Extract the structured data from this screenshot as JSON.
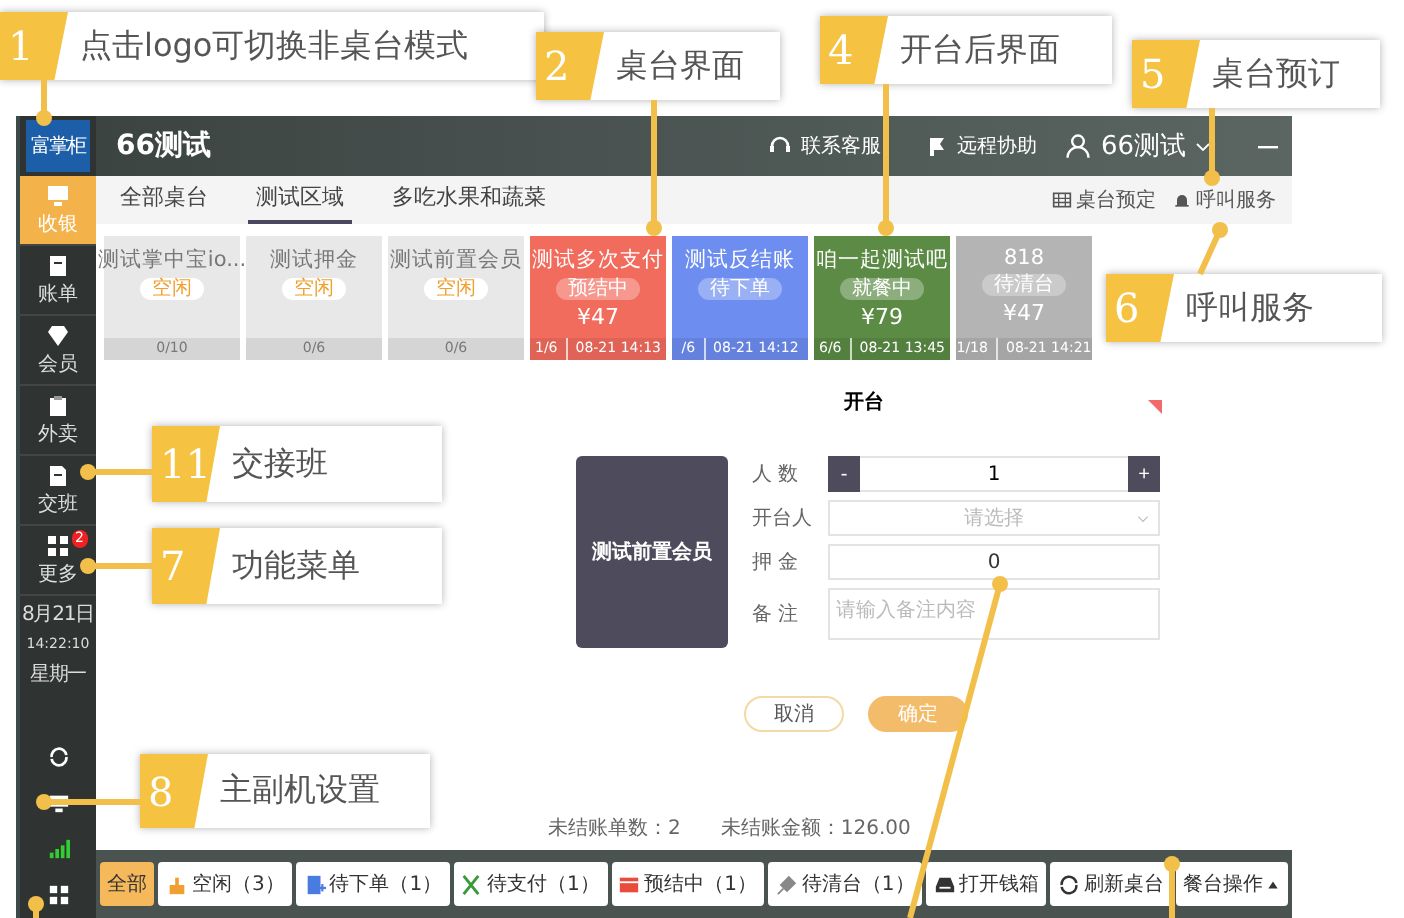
{
  "annotations": [
    {
      "number": "1",
      "text": "点击logo可切换非桌台模式"
    },
    {
      "number": "2",
      "text": "桌台界面"
    },
    {
      "number": "4",
      "text": "开台后界面"
    },
    {
      "number": "5",
      "text": "桌台预订"
    },
    {
      "number": "6",
      "text": "呼叫服务"
    },
    {
      "number": "11",
      "text": "交接班"
    },
    {
      "number": "7",
      "text": "功能菜单"
    },
    {
      "number": "8",
      "text": "主副机设置"
    }
  ],
  "sidebar": {
    "logo": "富掌柜",
    "items": [
      {
        "label": "收银",
        "selected": true
      },
      {
        "label": "账单",
        "selected": false
      },
      {
        "label": "会员",
        "selected": false
      },
      {
        "label": "外卖",
        "selected": false
      },
      {
        "label": "交班",
        "selected": false
      },
      {
        "label": "更多",
        "selected": false,
        "badge": "2"
      }
    ],
    "date": "8月21日",
    "time": "14:22:10",
    "weekday": "星期一"
  },
  "header": {
    "title": "66测试",
    "links": [
      "联系客服",
      "远程协助"
    ],
    "user": "66测试"
  },
  "tabs": [
    {
      "label": "全部桌台",
      "selected": false
    },
    {
      "label": "测试区域",
      "selected": true
    },
    {
      "label": "多吃水果和蔬菜",
      "selected": false
    }
  ],
  "tools": [
    "桌台预定",
    "呼叫服务"
  ],
  "tables": [
    {
      "name": "测试掌中宝io...",
      "status": "空闲",
      "kind": "idle",
      "color": "#e8e8e8",
      "count": "0/10"
    },
    {
      "name": "测试押金",
      "status": "空闲",
      "kind": "idle",
      "color": "#e8e8e8",
      "count": "0/6"
    },
    {
      "name": "测试前置会员",
      "status": "空闲",
      "kind": "idle",
      "color": "#e8e8e8",
      "count": "0/6"
    },
    {
      "name": "测试多次支付",
      "status": "预结中",
      "kind": "busy",
      "color": "#f26c5e",
      "price": "¥47",
      "count": "1/6",
      "time": "08-21 14:13"
    },
    {
      "name": "测试反结账",
      "status": "待下单",
      "kind": "busy",
      "color": "#6d8ef0",
      "count": "/6",
      "time": "08-21 14:12"
    },
    {
      "name": "咱一起测试吧",
      "status": "就餐中",
      "kind": "busy",
      "color": "#5b8b45",
      "price": "¥79",
      "count": "6/6",
      "time": "08-21 13:45"
    },
    {
      "name": "818",
      "status": "待清台",
      "kind": "busy",
      "color": "#b4b4b4",
      "price": "¥47",
      "count": "1/18",
      "time": "08-21 14:21"
    }
  ],
  "dialog": {
    "title": "开台",
    "table": "测试前置会员",
    "fields": [
      {
        "label": "人 数",
        "kind": "stepper",
        "minus": "-",
        "value": "1",
        "plus": "+"
      },
      {
        "label": "开台人",
        "kind": "select",
        "placeholder": "请选择"
      },
      {
        "label": "押 金",
        "kind": "input",
        "value": "0"
      },
      {
        "label": "备 注",
        "kind": "textarea",
        "placeholder": "请输入备注内容"
      }
    ],
    "buttons": [
      {
        "label": "取消",
        "primary": false
      },
      {
        "label": "确定",
        "primary": true
      }
    ]
  },
  "summary": [
    "未结账单数：2",
    "未结账金额：126.00"
  ],
  "filters": [
    {
      "label": "全部",
      "selected": true
    },
    {
      "label": "空闲（3）",
      "selected": false
    },
    {
      "label": "待下单（1）",
      "selected": false
    },
    {
      "label": "待支付（1）",
      "selected": false
    },
    {
      "label": "预结中（1）",
      "selected": false
    },
    {
      "label": "待清台（1）",
      "selected": false
    }
  ],
  "actions": [
    "打开钱箱",
    "刷新桌台",
    "餐台操作"
  ]
}
